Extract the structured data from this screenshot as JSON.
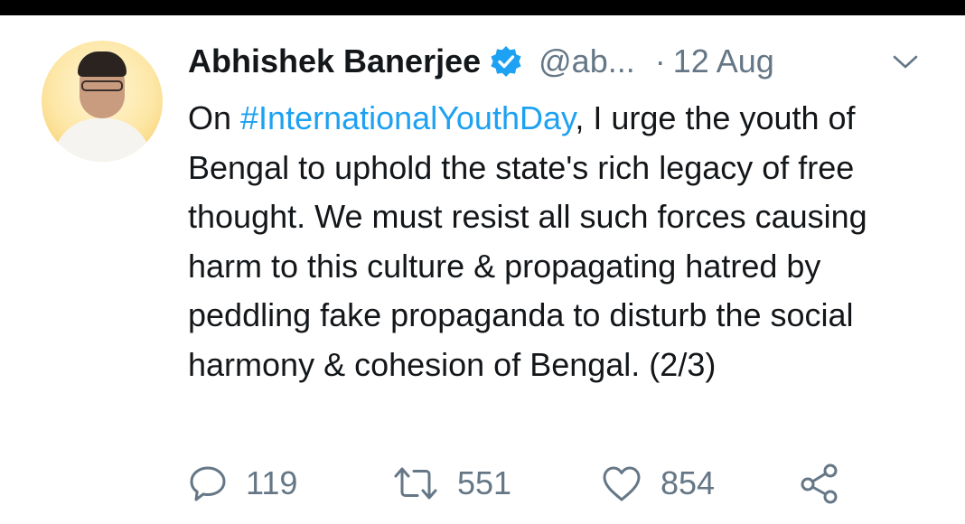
{
  "tweet": {
    "author_name": "Abhishek Banerjee",
    "handle": "@ab...",
    "separator": "·",
    "timestamp": "12 Aug",
    "text_prefix": "On ",
    "hashtag": "#InternationalYouthDay",
    "text_suffix": ", I urge the youth of Bengal to uphold the state's rich legacy of free thought. We must resist all such forces causing harm to this culture & propagating hatred by peddling fake propaganda to disturb the social harmony & cohesion of Bengal. (2/3)"
  },
  "actions": {
    "reply_count": "119",
    "retweet_count": "551",
    "like_count": "854"
  },
  "icons": {
    "verified": "verified-badge-icon",
    "menu": "chevron-down-icon",
    "reply": "reply-icon",
    "retweet": "retweet-icon",
    "like": "heart-icon",
    "share": "share-icon"
  },
  "colors": {
    "link": "#1da1f2",
    "secondary_text": "#657786",
    "primary_text": "#14171a",
    "top_bar": "#000000"
  }
}
